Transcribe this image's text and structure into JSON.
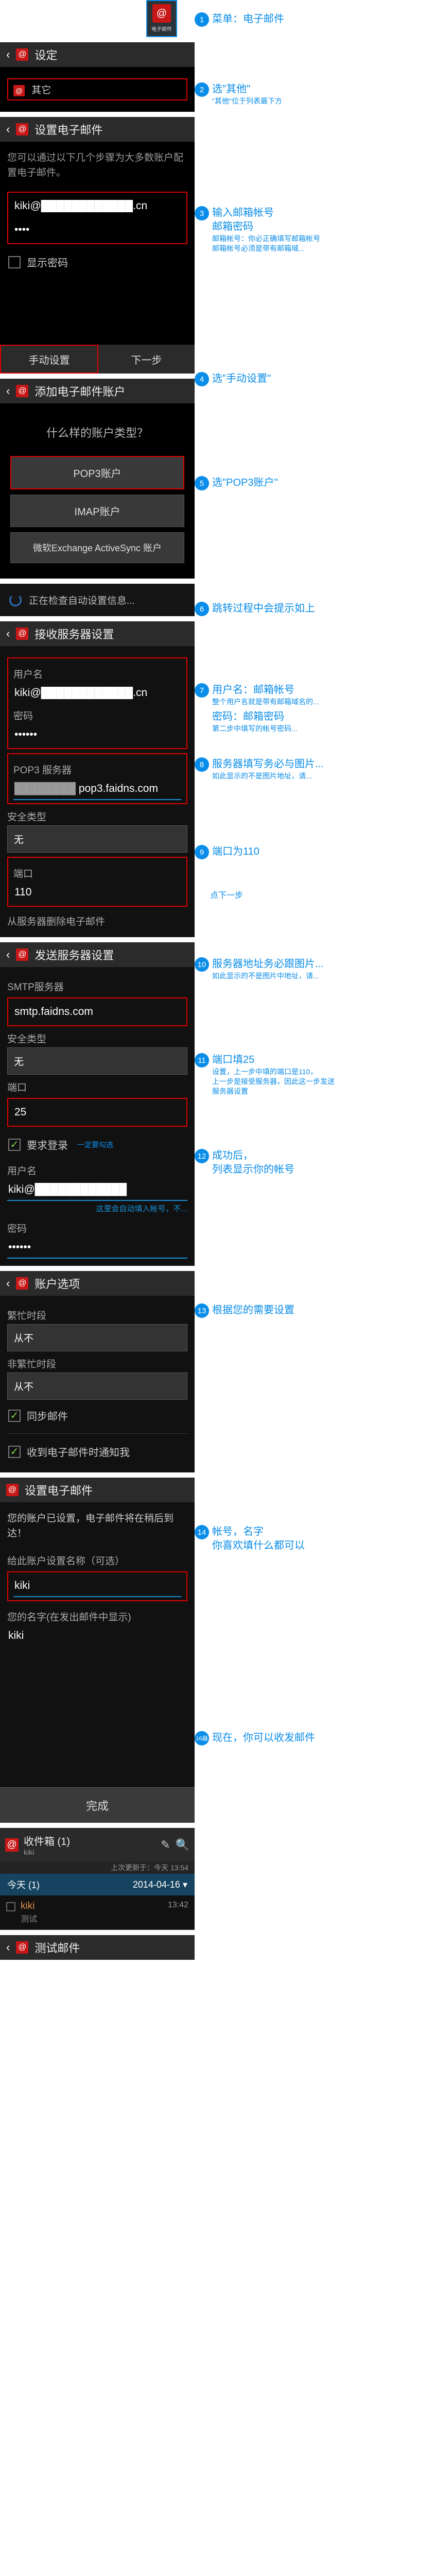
{
  "appIcon": {
    "label": "电子邮件"
  },
  "step1": "菜单：电子邮件",
  "settings": {
    "title": "设定",
    "other": "其它"
  },
  "step2": {
    "t": "选\"其他\"",
    "s": "\"其他\"位于列表最下方"
  },
  "setup": {
    "title": "设置电子邮件",
    "desc": "您可以通过以下几个步骤为大多数账户配置电子邮件。",
    "email": "kiki@████████████.cn",
    "showpw": "显示密码"
  },
  "step3": {
    "t": "输入邮箱帐号\n邮箱密码",
    "s": "邮箱帐号：你必正确填写邮箱帐号\n邮箱帐号必须是带有邮箱域..."
  },
  "manual": "手动设置",
  "next": "下一步",
  "step4": "选\"手动设置\"",
  "add": {
    "title": "添加电子邮件账户",
    "q": "什么样的账户类型？",
    "pop3": "POP3账户",
    "imap": "IMAP账户",
    "exchange": "微软Exchange ActiveSync 账户"
  },
  "step5": "选\"POP3账户\"",
  "checking": "正在检查自动设置信息...",
  "step6": "跳转过程中会提示如上",
  "recv": {
    "title": "接收服务器设置",
    "userLabel": "用户名",
    "user": "kiki@████████████.cn",
    "pwLabel": "密码",
    "pw": "••••••",
    "serverLabel": "POP3 服务器",
    "server": "pop3.faidns.com",
    "secLabel": "安全类型",
    "sec": "无",
    "portLabel": "端口",
    "port": "110",
    "del": "从服务器删除电子邮件"
  },
  "step7": {
    "t": "用户名：邮箱帐号",
    "s": "整个用户名就是带有邮箱域名的...",
    "t2": "密码：邮箱密码",
    "s2": "第二步中填写的帐号密码..."
  },
  "step8": {
    "t": "服务器填写务必与图片...",
    "s": "如此显示的不是图片地址，请..."
  },
  "step9": "端口为110",
  "step9b": "点下一步",
  "send": {
    "title": "发送服务器设置",
    "smtpLabel": "SMTP服务器",
    "smtp": "smtp.faidns.com",
    "secLabel": "安全类型",
    "sec": "无",
    "portLabel": "端口",
    "port": "25",
    "reqLogin": "要求登录",
    "reqNote": "一定要勾选",
    "userLabel": "用户名",
    "user": "kiki@████████████",
    "userNote": "这里会自动填入帐号，不...",
    "pwLabel": "密码",
    "pw": "••••••"
  },
  "step10": {
    "t": "服务器地址务必跟图片...",
    "s": "如此显示的不是图片中地址，请..."
  },
  "step11": {
    "t": "端口填25",
    "s": "设置，上一步中填的端口是110，\n上一步是接受服务器，因此这一步发送\n服务器设置"
  },
  "step12": {
    "t": "成功后，\n列表显示你的帐号"
  },
  "opts": {
    "title": "账户选项",
    "busyLabel": "繁忙时段",
    "busy": "从不",
    "idleLabel": "非繁忙时段",
    "idle": "从不",
    "sync": "同步邮件",
    "notify": "收到电子邮件时通知我"
  },
  "step13": "根据您的需要设置",
  "final": {
    "title": "设置电子邮件",
    "msg": "您的账户已设置，电子邮件将在稍后到达！",
    "nameLabel": "给此账户设置名称（可选）",
    "name": "kiki",
    "sigLabel": "您的名字(在发出邮件中显示)",
    "sig": "kiki",
    "done": "完成"
  },
  "step14": "帐号，名字\n你喜欢填什么都可以",
  "step15": "",
  "step16": "现在，你可以收发邮件",
  "inbox": {
    "title": "收件箱 (1)",
    "acct": "kiki",
    "updated": "上次更新于：今天 13:54",
    "today": "今天 (1)",
    "date": "2014-04-16",
    "from": "kiki",
    "subject": "测试",
    "time": "13:42",
    "test": "测试邮件"
  }
}
